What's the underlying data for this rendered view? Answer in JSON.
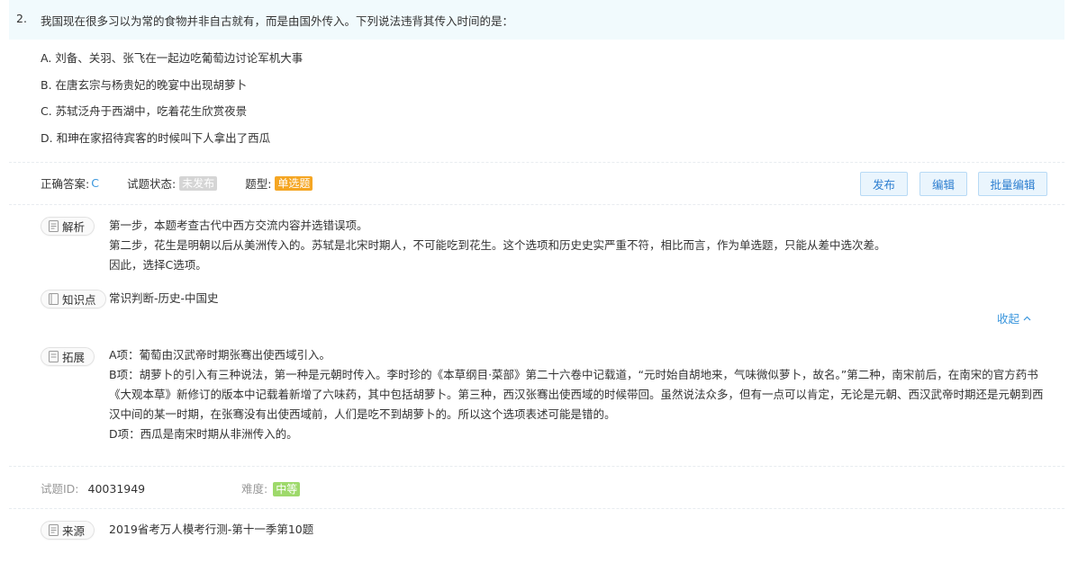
{
  "question": {
    "number": "2.",
    "text": "我国现在很多习以为常的食物并非自古就有，而是由国外传入。下列说法违背其传入时间的是：",
    "options": [
      "A.  刘备、关羽、张飞在一起边吃葡萄边讨论军机大事",
      "B.  在唐玄宗与杨贵妃的晚宴中出现胡萝卜",
      "C.  苏轼泛舟于西湖中，吃着花生欣赏夜景",
      "D.  和珅在家招待宾客的时候叫下人拿出了西瓜"
    ]
  },
  "meta": {
    "answer_label": "正确答案:",
    "answer_value": "C",
    "status_label": "试题状态:",
    "status_value": "未发布",
    "type_label": "题型:",
    "type_value": "单选题"
  },
  "buttons": {
    "publish": "发布",
    "edit": "编辑",
    "batch_edit": "批量编辑"
  },
  "analysis": {
    "tag": "解析",
    "lines": [
      "第一步，本题考查古代中西方交流内容并选错误项。",
      "第二步，花生是明朝以后从美洲传入的。苏轼是北宋时期人，不可能吃到花生。这个选项和历史史实严重不符，相比而言，作为单选题，只能从差中选次差。",
      "因此，选择C选项。"
    ]
  },
  "knowledge": {
    "tag": "知识点",
    "text": "常识判断-历史-中国史"
  },
  "collapse_label": "收起",
  "extension": {
    "tag": "拓展",
    "line_a": "A项：葡萄由汉武帝时期张骞出使西域引入。",
    "line_b": "B项：胡萝卜的引入有三种说法，第一种是元朝时传入。李时珍的《本草纲目·菜部》第二十六卷中记载道，“元时始自胡地来，气味微似萝卜，故名。”第二种，南宋前后，在南宋的官方药书《大观本草》新修订的版本中记载着新增了六味药，其中包括胡萝卜。第三种，西汉张骞出使西域的时候带回。虽然说法众多，但有一点可以肯定，无论是元朝、西汉武帝时期还是元朝到西汉中间的某一时期，在张骞没有出使西域前，人们是吃不到胡萝卜的。所以这个选项表述可能是错的。",
    "line_d": "D项：西瓜是南宋时期从非洲传入的。"
  },
  "footer": {
    "id_label": "试题ID:",
    "id_value": "40031949",
    "difficulty_label": "难度:",
    "difficulty_value": "中等"
  },
  "source": {
    "tag": "来源",
    "text": "2019省考万人模考行测-第十一季第10题"
  },
  "colors": {
    "accent": "#3a96dd",
    "header_bg": "#f1fafd",
    "badge_gray": "#d5d5d5",
    "badge_orange": "#f5a623",
    "badge_green": "#9ed96b"
  }
}
